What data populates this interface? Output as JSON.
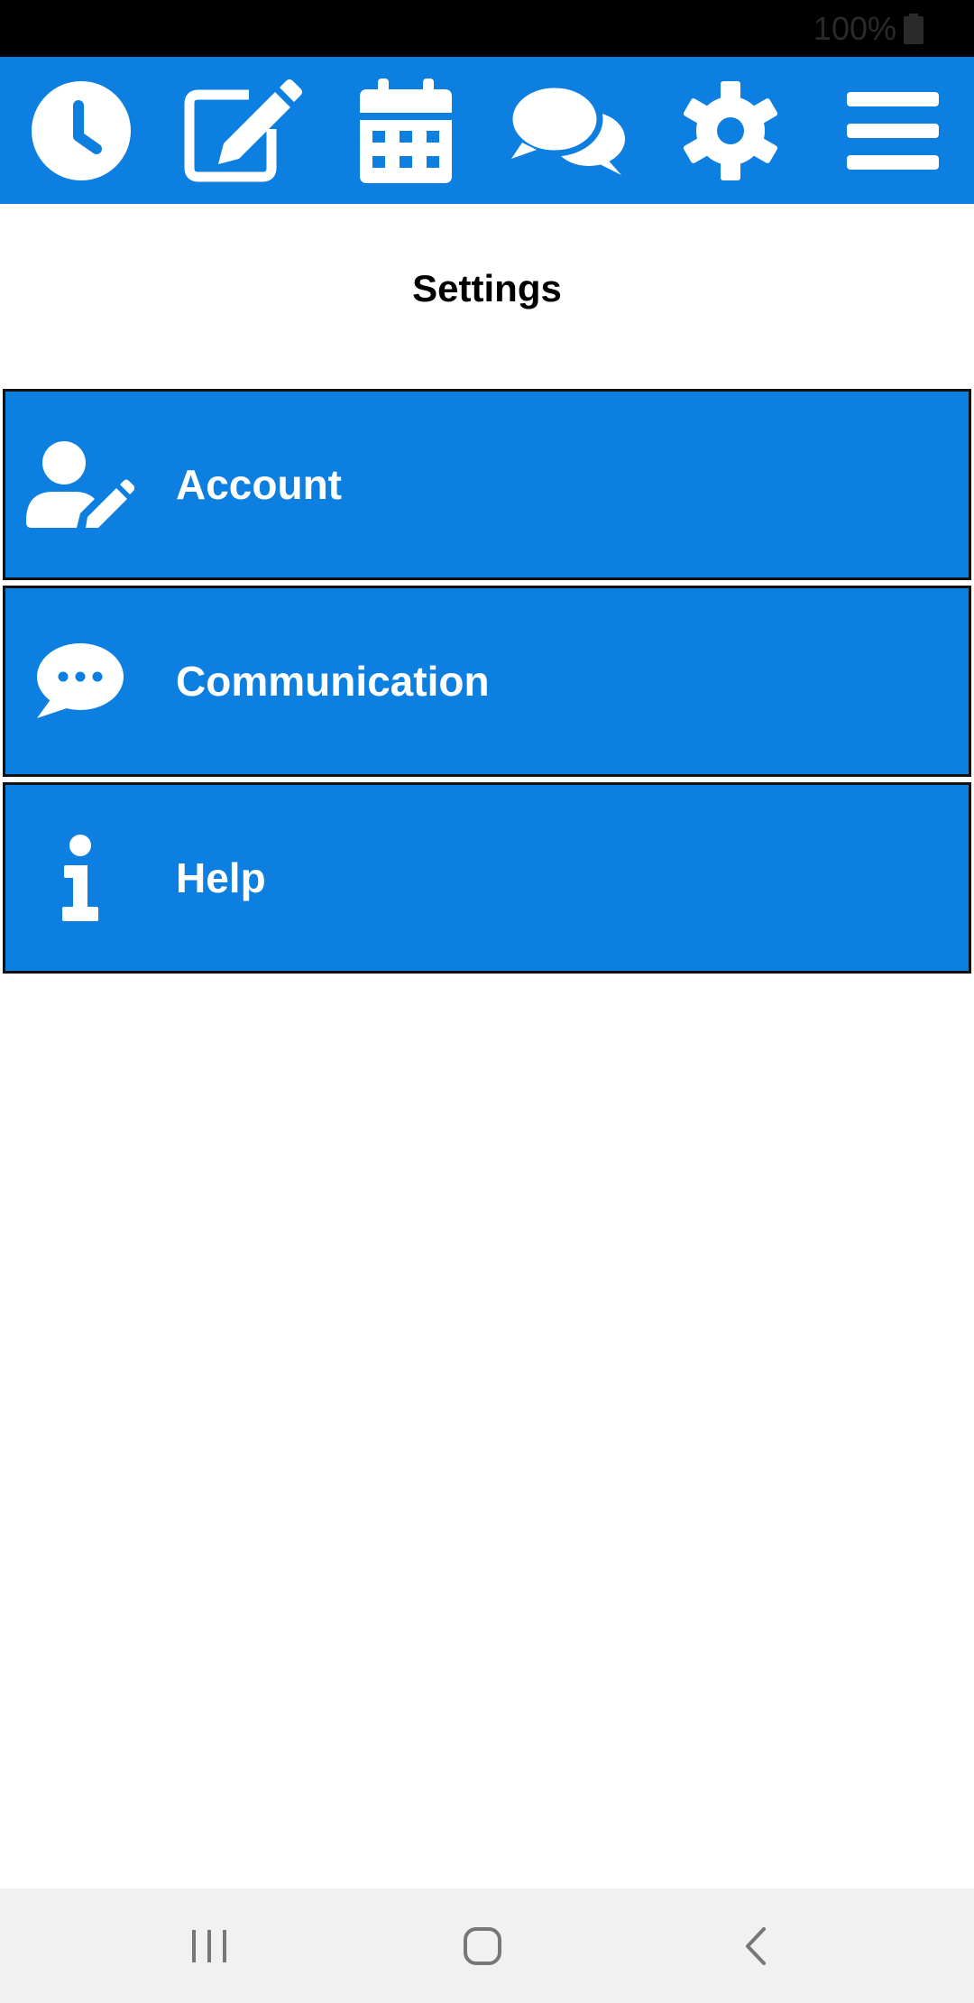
{
  "status_bar": {
    "battery_text": "100%",
    "battery_icon": "battery-full-icon"
  },
  "colors": {
    "accent": "#0d7fe0",
    "status_bar": "#000000",
    "nav_bar": "#f1f1f1",
    "text_on_accent": "#ffffff"
  },
  "top_nav": {
    "icons": [
      "clock-icon",
      "edit-icon",
      "calendar-icon",
      "chat-bubbles-icon",
      "gear-icon",
      "hamburger-menu-icon"
    ]
  },
  "page": {
    "title": "Settings"
  },
  "menu": {
    "items": [
      {
        "label": "Account",
        "icon": "user-edit-icon"
      },
      {
        "label": "Communication",
        "icon": "speech-bubble-dots-icon"
      },
      {
        "label": "Help",
        "icon": "info-icon"
      }
    ]
  },
  "system_nav": {
    "icons": [
      "recent-apps-icon",
      "home-icon",
      "back-icon"
    ]
  }
}
